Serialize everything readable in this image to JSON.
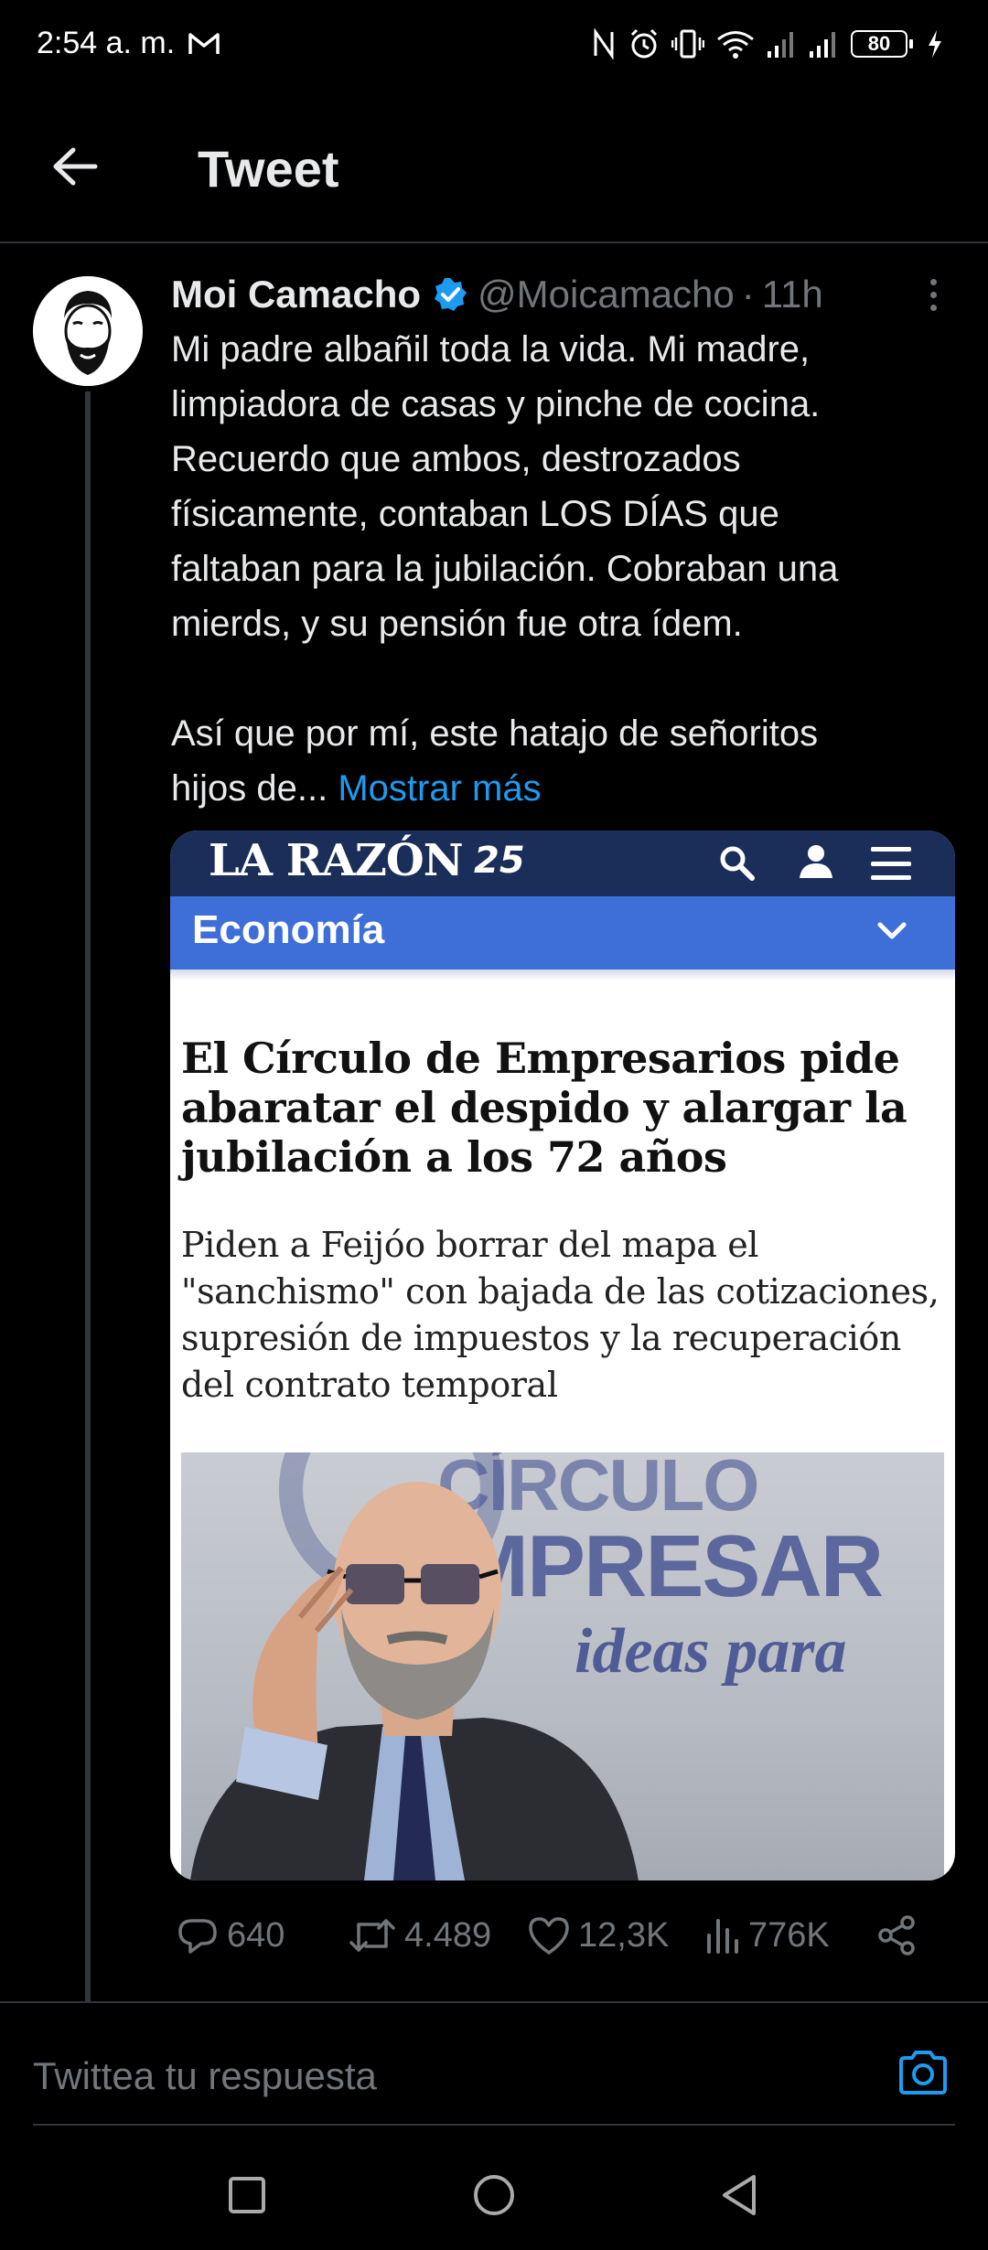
{
  "status_bar": {
    "time": "2:54 a. m.",
    "battery": "80",
    "icons": [
      "gmail-icon",
      "nfc-icon",
      "alarm-icon",
      "vibrate-icon",
      "wifi-icon",
      "signal-icon",
      "signal-icon",
      "battery-icon",
      "charging-icon"
    ]
  },
  "header": {
    "title": "Tweet",
    "back_icon": "arrow-left-icon"
  },
  "tweet": {
    "author_name": "Moi Camacho",
    "handle": "@Moicamacho",
    "separator": "·",
    "time": "11h",
    "lines": [
      "Mi padre albañil toda la vida. Mi madre,",
      "limpiadora de casas y pinche de cocina.",
      "Recuerdo que ambos, destrozados",
      "físicamente, contaban LOS DÍAS que",
      "faltaban para la jubilación. Cobraban una",
      "mierds, y su pensión fue otra ídem."
    ],
    "line2_start": "Así que por mí, este hatajo de señoritos",
    "line2_end": "hijos de...",
    "show_more": "Mostrar más",
    "media": {
      "logo": "LA RAZÓN",
      "logo_badge": "25",
      "section": "Economía",
      "headline": "El Círculo de Empresarios pide abaratar el despido y alargar la jubilación a los 72 años",
      "subtitle": "Piden a Feijóo borrar del mapa el \"sanchismo\" con bajada de las cotizaciones, supresión de impuestos y la recuperación del contrato temporal",
      "photo_text_1": "CÍRCULO",
      "photo_text_2": "MPRESAR",
      "photo_text_3": "ideas para"
    },
    "actions": {
      "replies": "640",
      "retweets": "4.489",
      "likes": "12,3K",
      "views": "776K"
    }
  },
  "reply": {
    "placeholder": "Twittea tu respuesta"
  },
  "colors": {
    "background": "#000000",
    "accent": "#1d9bf0",
    "muted": "#71767b",
    "larazon_navy": "#1b2e59",
    "larazon_blue": "#3e6fd9"
  }
}
